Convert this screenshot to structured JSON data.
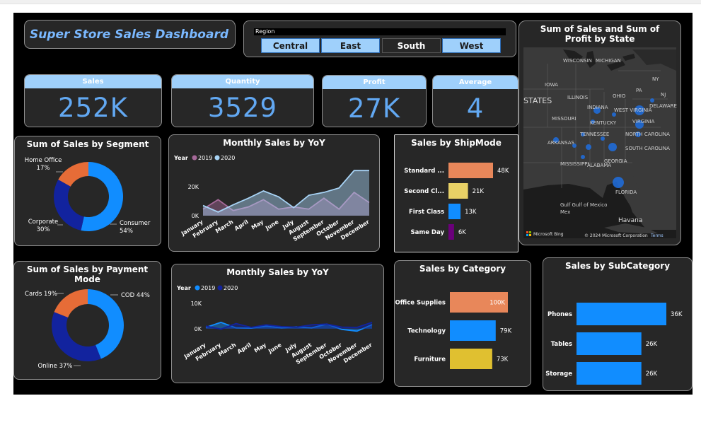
{
  "dashboard_title": "Super Store Sales Dashboard",
  "region_slicer": {
    "label": "Region",
    "options": [
      {
        "label": "Central",
        "selected": true
      },
      {
        "label": "East",
        "selected": true
      },
      {
        "label": "South",
        "selected": false
      },
      {
        "label": "West",
        "selected": true
      }
    ]
  },
  "kpis": {
    "sales": {
      "label": "Sales",
      "value": "252K"
    },
    "quantity": {
      "label": "Quantity",
      "value": "3529"
    },
    "profit": {
      "label": "Profit",
      "value": "27K"
    },
    "average": {
      "label": "Average",
      "value": "4"
    }
  },
  "map": {
    "title": "Sum of Sales and Sum of Profit by State",
    "labels": [
      "WISCONSIN",
      "MICHIGAN",
      "IOWA",
      "ILLINOIS",
      "OHIO",
      "PA",
      "NY",
      "INDIANA",
      "STATES",
      "MISSOURI",
      "KENTUCKY",
      "WEST VIRGINIA",
      "VIRGINIA",
      "DELAWARE",
      "NJ",
      "TENNESSEE",
      "NORTH CAROLINA",
      "ARKANSAS",
      "SOUTH CAROLINA",
      "MISSISSIPPI",
      "ALABAMA",
      "GEORGIA",
      "FLORIDA",
      "Gulf Gulf of Mexico",
      "Mex",
      "Havana"
    ],
    "attribution_left": "Microsoft Bing",
    "attribution_right": "© 2024 Microsoft Corporation",
    "terms": "Terms",
    "bubble_color": "#1f6fe0"
  },
  "colors": {
    "background": "#000000",
    "card": "#272727",
    "accent": "#62a8f2",
    "header": "#9fd0fb",
    "blue": "#118dff",
    "navy": "#12239e",
    "orange": "#e66c37",
    "purple": "#6b007b",
    "salmon": "#e8875a",
    "yellow": "#e8d166",
    "gold": "#e0c030",
    "violet": "#a66999",
    "lightblue": "#a8d4f6"
  },
  "chart_data": [
    {
      "id": "segment",
      "type": "pie",
      "title": "Sum of Sales by Segment",
      "donut": true,
      "slices": [
        {
          "label": "Consumer",
          "pct": "54%",
          "value": 54,
          "color": "#118dff"
        },
        {
          "label": "Corporate",
          "pct": "30%",
          "value": 30,
          "color": "#12239e"
        },
        {
          "label": "Home Office",
          "pct": "17%",
          "value": 17,
          "color": "#e66c37"
        }
      ]
    },
    {
      "id": "yoy_area",
      "type": "area",
      "title": "Monthly Sales by YoY",
      "legend_title": "Year",
      "legend_position": "top-left",
      "categories": [
        "January",
        "February",
        "March",
        "April",
        "May",
        "June",
        "July",
        "August",
        "September",
        "October",
        "November",
        "December"
      ],
      "y_ticks": [
        "0K",
        "20K"
      ],
      "ylim": [
        0,
        34000
      ],
      "series": [
        {
          "name": "2019",
          "color": "#a66999",
          "values": [
            4500,
            11000,
            3500,
            6000,
            11000,
            4500,
            6000,
            4500,
            12000,
            4500,
            16000,
            9000
          ]
        },
        {
          "name": "2020",
          "color": "#a8d4f6",
          "values": [
            7000,
            2500,
            7500,
            12000,
            17000,
            13000,
            5500,
            14000,
            16000,
            19000,
            31000,
            31000
          ]
        }
      ]
    },
    {
      "id": "shipmode",
      "type": "bar",
      "orientation": "horizontal",
      "title": "Sales by ShipMode",
      "categories": [
        "Standard ...",
        "Second Cl...",
        "First Class",
        "Same Day"
      ],
      "values": [
        48,
        21,
        13,
        6
      ],
      "value_labels": [
        "48K",
        "21K",
        "13K",
        "6K"
      ],
      "colors": [
        "#e8875a",
        "#e8d166",
        "#118dff",
        "#6b007b"
      ],
      "xlim": [
        0,
        48
      ]
    },
    {
      "id": "payment",
      "type": "pie",
      "title": "Sum of Sales by Payment Mode",
      "donut": true,
      "slices": [
        {
          "label": "COD",
          "pct": "44%",
          "value": 44,
          "color": "#118dff"
        },
        {
          "label": "Online",
          "pct": "37%",
          "value": 37,
          "color": "#12239e"
        },
        {
          "label": "Cards",
          "pct": "19%",
          "value": 19,
          "color": "#e66c37"
        }
      ]
    },
    {
      "id": "yoy_line",
      "type": "area",
      "title": "Monthly Sales by YoY",
      "legend_title": "Year",
      "legend_position": "top-left",
      "categories": [
        "January",
        "February",
        "March",
        "April",
        "May",
        "June",
        "July",
        "August",
        "September",
        "October",
        "November",
        "December"
      ],
      "y_ticks": [
        "0K",
        "10K"
      ],
      "ylim": [
        -4000,
        12000
      ],
      "series": [
        {
          "name": "2019",
          "color": "#118dff",
          "values": [
            500,
            2500,
            300,
            200,
            1000,
            300,
            700,
            300,
            1800,
            -300,
            -1000,
            1600
          ]
        },
        {
          "name": "2020",
          "color": "#12239e",
          "values": [
            1000,
            -200,
            2000,
            500,
            1500,
            800,
            600,
            1500,
            1800,
            600,
            500,
            2500
          ]
        }
      ]
    },
    {
      "id": "category",
      "type": "bar",
      "orientation": "horizontal",
      "title": "Sales by Category",
      "categories": [
        "Office Supplies",
        "Technology",
        "Furniture"
      ],
      "values": [
        100,
        79,
        73
      ],
      "value_labels": [
        "100K",
        "79K",
        "73K"
      ],
      "colors": [
        "#e8875a",
        "#118dff",
        "#e0c030"
      ],
      "xlim": [
        0,
        100
      ]
    },
    {
      "id": "subcategory",
      "type": "bar",
      "orientation": "horizontal",
      "title": "Sales by SubCategory",
      "categories": [
        "Phones",
        "Tables",
        "Storage"
      ],
      "values": [
        36,
        26,
        26
      ],
      "value_labels": [
        "36K",
        "26K",
        "26K"
      ],
      "colors": [
        "#118dff",
        "#118dff",
        "#118dff"
      ],
      "xlim": [
        0,
        36
      ]
    }
  ]
}
